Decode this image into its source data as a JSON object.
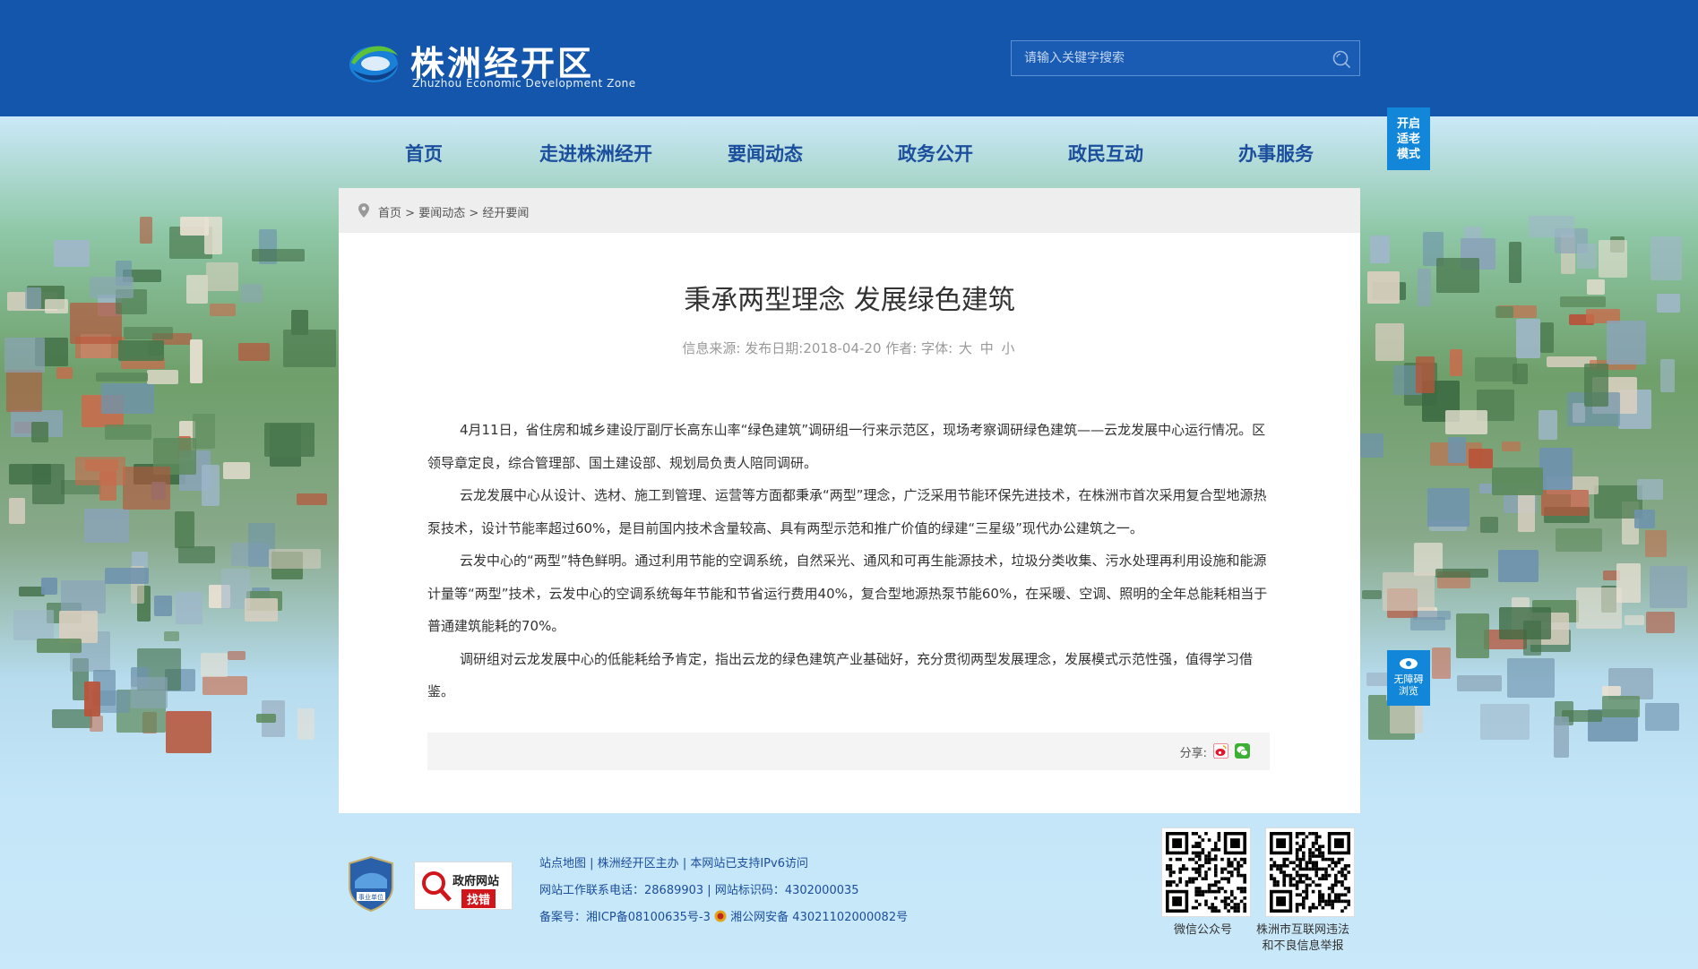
{
  "header": {
    "logo_cn": "株洲经开区",
    "logo_en": "Zhuzhou Economic Development Zone",
    "search_placeholder": "请输入关键字搜索"
  },
  "nav": {
    "items": [
      "首页",
      "走进株洲经开",
      "要闻动态",
      "政务公开",
      "政民互动",
      "办事服务"
    ]
  },
  "side": {
    "elder_mode": [
      "开启",
      "适老",
      "模式"
    ],
    "accessible": [
      "无障碍",
      "浏览"
    ]
  },
  "breadcrumb": {
    "home": "首页",
    "section": "要闻动态",
    "current": "经开要闻",
    "sep": ">"
  },
  "article": {
    "title": "秉承两型理念 发展绿色建筑",
    "meta_source": "信息来源:",
    "meta_date": "发布日期:2018-04-20 作者:",
    "meta_font": "字体:",
    "font_large": "大",
    "font_medium": "中",
    "font_small": "小",
    "paragraphs": [
      "4月11日，省住房和城乡建设厅副厅长高东山率“绿色建筑”调研组一行来示范区，现场考察调研绿色建筑——云龙发展中心运行情况。区领导章定良，综合管理部、国土建设部、规划局负责人陪同调研。",
      "云龙发展中心从设计、选材、施工到管理、运营等方面都秉承“两型”理念，广泛采用节能环保先进技术，在株洲市首次采用复合型地源热泵技术，设计节能率超过60%，是目前国内技术含量较高、具有两型示范和推广价值的绿建“三星级”现代办公建筑之一。",
      "云发中心的“两型”特色鲜明。通过利用节能的空调系统，自然采光、通风和可再生能源技术，垃圾分类收集、污水处理再利用设施和能源计量等“两型”技术，云发中心的空调系统每年节能和节省运行费用40%，复合型地源热泵节能60%，在采暖、空调、照明的全年总能耗相当于普通建筑能耗的70%。",
      "调研组对云龙发展中心的低能耗给予肯定，指出云龙的绿色建筑产业基础好，充分贯彻两型发展理念，发展模式示范性强，值得学习借鉴。"
    ],
    "share_label": "分享:"
  },
  "footer": {
    "badge_text": "事业单位",
    "gov_site": "政府网站",
    "gov_error": "找错",
    "links": [
      "站点地图",
      "株洲经开区主办",
      "本网站已支持IPv6访问"
    ],
    "contact": "网站工作联系电话：28689903",
    "site_id": "网站标识码：4302000035",
    "icp": "备案号：湘ICP备08100635号-3",
    "police": "湘公网安备 43021102000082号",
    "qr1_label": "微信公众号",
    "qr2_label": [
      "株洲市互联网违法",
      "和不良信息举报"
    ]
  },
  "colors": {
    "header_bg": "#1556ad",
    "nav_text": "#1b4e9c",
    "side_button": "#1287d9",
    "weibo": "#e6162d",
    "wechat": "#3cb034"
  }
}
